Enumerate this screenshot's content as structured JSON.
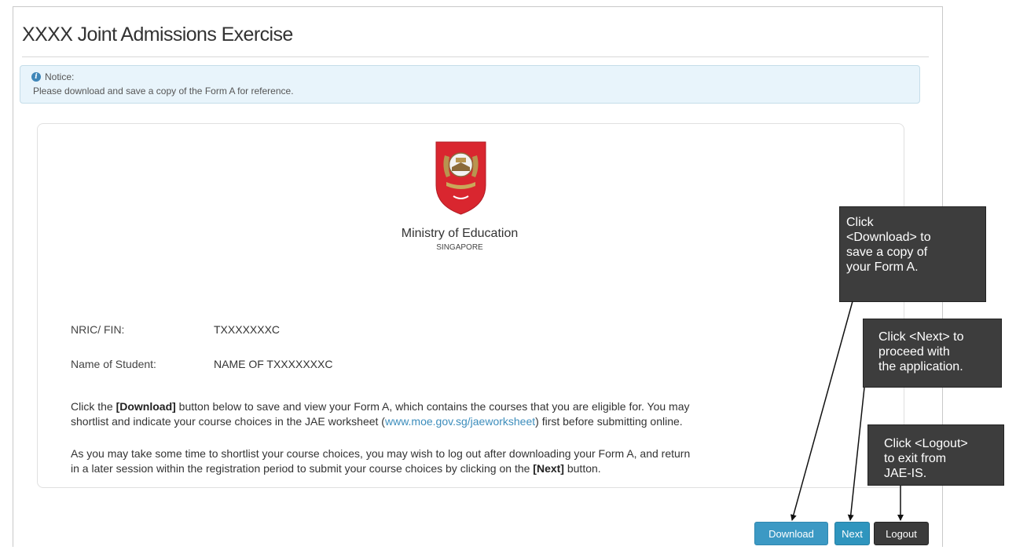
{
  "page": {
    "title": "XXXX Joint Admissions Exercise"
  },
  "notice": {
    "icon": "info-icon",
    "title": "Notice:",
    "text": "Please download and save a copy of the Form A for reference."
  },
  "ministry": {
    "crest_icon": "moe-crest-icon",
    "name": "Ministry of Education",
    "country": "SINGAPORE"
  },
  "student": {
    "nric_label": "NRIC/ FIN:",
    "nric_value": "TXXXXXXXC",
    "name_label": "Name of Student:",
    "name_value": "NAME OF TXXXXXXXC"
  },
  "instructions": {
    "p1_prefix": "Click the ",
    "p1_bold": "[Download]",
    "p1_line1_rest": " button below to save and view your Form A, which contains the courses that you are eligible for. You may",
    "p1_line2_start": "shortlist and indicate your course choices in the JAE worksheet (",
    "p1_link": "www.moe.gov.sg/jaeworksheet",
    "p1_line2_end": ") first before submitting online.",
    "p2_line1": "As you may take some time to shortlist your course choices, you may wish to log out after downloading your Form A, and return",
    "p2_line2_start": "in a later session within the registration period to submit your course choices by clicking on the ",
    "p2_bold": "[Next]",
    "p2_line2_end": " button."
  },
  "buttons": {
    "download": "Download",
    "next": "Next",
    "logout": "Logout"
  },
  "callouts": {
    "download": [
      "Click",
      "<Download> to",
      "save a copy of",
      "your Form A."
    ],
    "next": [
      "Click <Next> to",
      "proceed with",
      "the application."
    ],
    "logout": [
      "Click <Logout>",
      "to exit from",
      "JAE-IS."
    ]
  },
  "colors": {
    "primary_button": "#3c99c4",
    "logout_button": "#3b3b3b",
    "notice_bg": "#e8f4fb",
    "link": "#3c8dbc",
    "callout_bg": "#3d3d3d",
    "crest_red": "#d9262f"
  }
}
